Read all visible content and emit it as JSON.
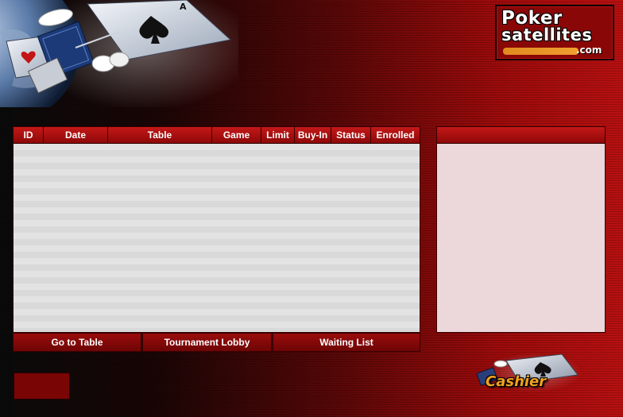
{
  "logo": {
    "line1": "Poker",
    "line2": "satellites",
    "line3": ".com"
  },
  "hero": {
    "icons": [
      "earth-icon",
      "satellite-icon",
      "ace-of-spades-card-icon",
      "hearts-card-icon"
    ]
  },
  "table": {
    "columns": [
      "ID",
      "Date",
      "Table",
      "Game",
      "Limit",
      "Buy-In",
      "Status",
      "Enrolled"
    ],
    "rows": []
  },
  "side_panel": {
    "title": ""
  },
  "actions": {
    "go_to_table": "Go to Table",
    "tournament_lobby": "Tournament Lobby",
    "waiting_list": "Waiting List"
  },
  "cashier": {
    "label": "Cashier"
  },
  "colors": {
    "header_red": "#c41818",
    "button_red": "#8e0808",
    "row_light": "#e3e3e3",
    "panel_pink": "#ecd7da",
    "cashier_orange": "#f2a21e"
  }
}
